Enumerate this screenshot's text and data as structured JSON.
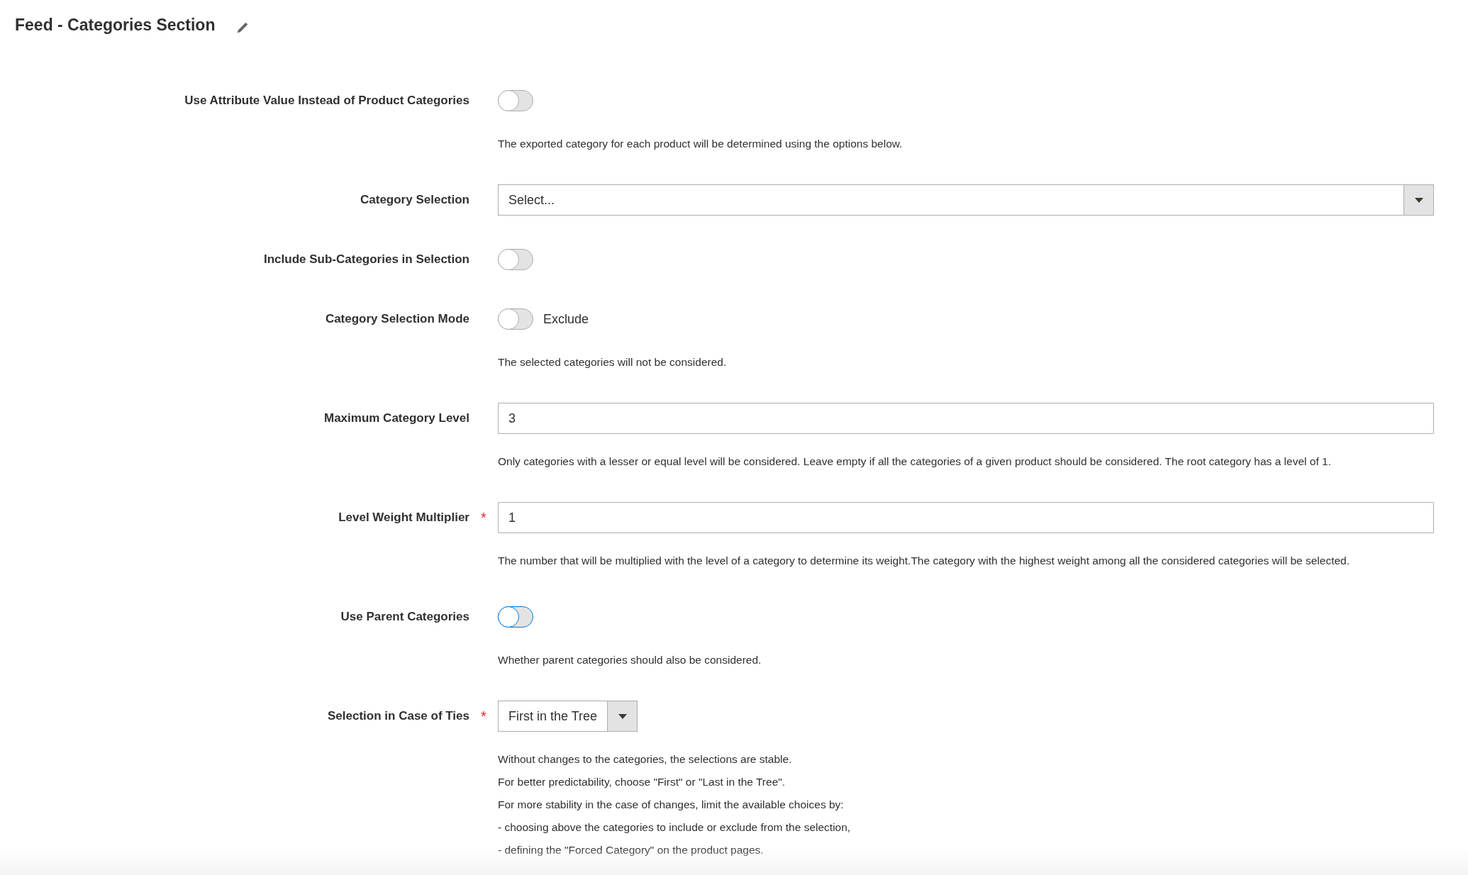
{
  "title": "Feed - Categories Section",
  "fields": [
    {
      "kind": "toggle",
      "label": "Use Attribute Value Instead of Product Categories",
      "on": false,
      "focused": false,
      "notes": [
        "The exported category for each product will be determined using the options below."
      ]
    },
    {
      "kind": "select",
      "label": "Category Selection",
      "value": "Select...",
      "wide": true
    },
    {
      "kind": "toggle",
      "label": "Include Sub-Categories in Selection",
      "on": false,
      "focused": false
    },
    {
      "kind": "toggle",
      "label": "Category Selection Mode",
      "on": false,
      "focused": false,
      "state_text": "Exclude",
      "notes": [
        "The selected categories will not be considered."
      ]
    },
    {
      "kind": "input",
      "label": "Maximum Category Level",
      "value": "3",
      "notes": [
        "Only categories with a lesser or equal level will be considered. Leave empty if all the categories of a given product should be considered. The root category has a level of 1."
      ]
    },
    {
      "kind": "input",
      "label": "Level Weight Multiplier",
      "required_mark": "*",
      "value": "1",
      "notes": [
        "The number that will be multiplied with the level of a category to determine its weight.The category with the highest weight among all the considered categories will be selected."
      ]
    },
    {
      "kind": "toggle",
      "label": "Use Parent Categories",
      "on": false,
      "focused": true,
      "notes": [
        "Whether parent categories should also be considered."
      ]
    },
    {
      "kind": "select",
      "label": "Selection in Case of Ties",
      "required_mark": "*",
      "value": "First in the Tree",
      "wide": false,
      "notes": [
        "Without changes to the categories, the selections are stable.",
        "For better predictability, choose \"First\" or \"Last in the Tree\".",
        "For more stability in the case of changes, limit the available choices by:",
        "- choosing above the categories to include or exclude from the selection,",
        "- defining the \"Forced Category\" on the product pages."
      ]
    }
  ]
}
